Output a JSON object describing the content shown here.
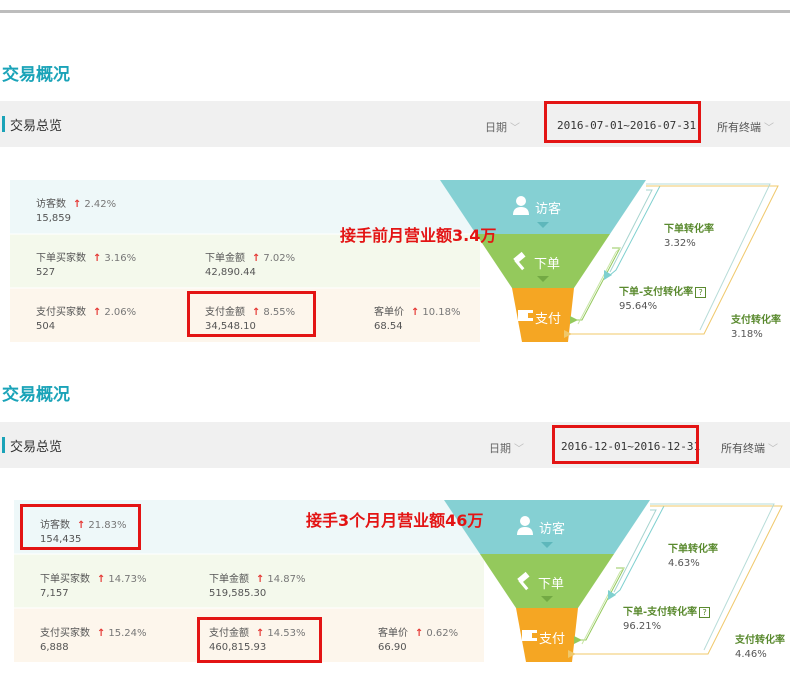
{
  "sections": [
    {
      "title": "交易概况",
      "overview_label": "交易总览",
      "date_label": "日期",
      "date_range": "2016-07-01~2016-07-31",
      "terminal_label": "所有终端",
      "annotation": "接手前月营业额3.4万",
      "metrics": {
        "visitors": {
          "name": "访客数",
          "pct": "2.42%",
          "value": "15,859"
        },
        "order_buyers": {
          "name": "下单买家数",
          "pct": "3.16%",
          "value": "527"
        },
        "order_amount": {
          "name": "下单金额",
          "pct": "7.02%",
          "value": "42,890.44"
        },
        "pay_buyers": {
          "name": "支付买家数",
          "pct": "2.06%",
          "value": "504"
        },
        "pay_amount": {
          "name": "支付金额",
          "pct": "8.55%",
          "value": "34,548.10"
        },
        "unit_price": {
          "name": "客单价",
          "pct": "10.18%",
          "value": "68.54"
        }
      },
      "funnel": {
        "visitors": "访客",
        "order": "下单",
        "pay": "支付"
      },
      "rates": {
        "order_rate_label": "下单转化率",
        "order_rate": "3.32%",
        "order_pay_rate_label": "下单-支付转化率",
        "order_pay_rate": "95.64%",
        "pay_rate_label": "支付转化率",
        "pay_rate": "3.18%"
      }
    },
    {
      "title": "交易概况",
      "overview_label": "交易总览",
      "date_label": "日期",
      "date_range": "2016-12-01~2016-12-31",
      "terminal_label": "所有终端",
      "annotation": "接手3个月月营业额46万",
      "metrics": {
        "visitors": {
          "name": "访客数",
          "pct": "21.83%",
          "value": "154,435"
        },
        "order_buyers": {
          "name": "下单买家数",
          "pct": "14.73%",
          "value": "7,157"
        },
        "order_amount": {
          "name": "下单金额",
          "pct": "14.87%",
          "value": "519,585.30"
        },
        "pay_buyers": {
          "name": "支付买家数",
          "pct": "15.24%",
          "value": "6,888"
        },
        "pay_amount": {
          "name": "支付金额",
          "pct": "14.53%",
          "value": "460,815.93"
        },
        "unit_price": {
          "name": "客单价",
          "pct": "0.62%",
          "value": "66.90"
        }
      },
      "funnel": {
        "visitors": "访客",
        "order": "下单",
        "pay": "支付"
      },
      "rates": {
        "order_rate_label": "下单转化率",
        "order_rate": "4.63%",
        "order_pay_rate_label": "下单-支付转化率",
        "order_pay_rate": "96.21%",
        "pay_rate_label": "支付转化率",
        "pay_rate": "4.46%"
      }
    }
  ],
  "icons": {
    "user": "user-icon",
    "hammer": "hammer-icon",
    "wallet": "wallet-icon",
    "arrow_up": "arrow-up-icon",
    "help": "help-icon",
    "chevron": "chevron-down-icon"
  },
  "colors": {
    "accent": "#1aa3b8",
    "highlight_red": "#e31414",
    "funnel_visitors": "#85d0d3",
    "funnel_order": "#94c95c",
    "funnel_pay": "#f5a623",
    "row_visitors_bg": "#eef8f9",
    "row_order_bg": "#f4f9ec",
    "row_pay_bg": "#fdf6ec",
    "increase_arrow": "#e53935"
  }
}
